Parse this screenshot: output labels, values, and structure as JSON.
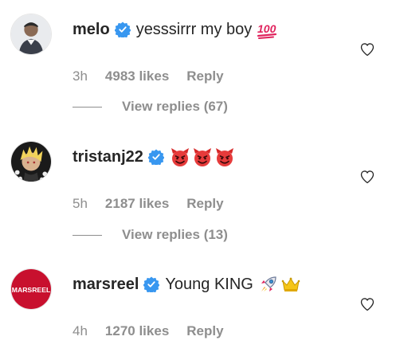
{
  "colors": {
    "verified": "#3897f0",
    "muted": "#8e8e8e",
    "text": "#262626"
  },
  "comments": [
    {
      "username": "melo",
      "text": "yesssirrr my boy",
      "emojis": [
        "hundred-points-emoji"
      ],
      "time": "3h",
      "likes": "4983 likes",
      "reply": "Reply",
      "view_replies": "View replies (67)"
    },
    {
      "username": "tristanj22",
      "text": "",
      "emojis": [
        "smiling-devil-emoji",
        "smiling-devil-emoji",
        "smiling-devil-emoji"
      ],
      "time": "5h",
      "likes": "2187 likes",
      "reply": "Reply",
      "view_replies": "View replies (13)"
    },
    {
      "username": "marsreel",
      "text": "Young KING",
      "emojis": [
        "rocket-emoji",
        "crown-emoji"
      ],
      "time": "4h",
      "likes": "1270 likes",
      "reply": "Reply",
      "avatar_logo": "MARSREEL"
    }
  ]
}
